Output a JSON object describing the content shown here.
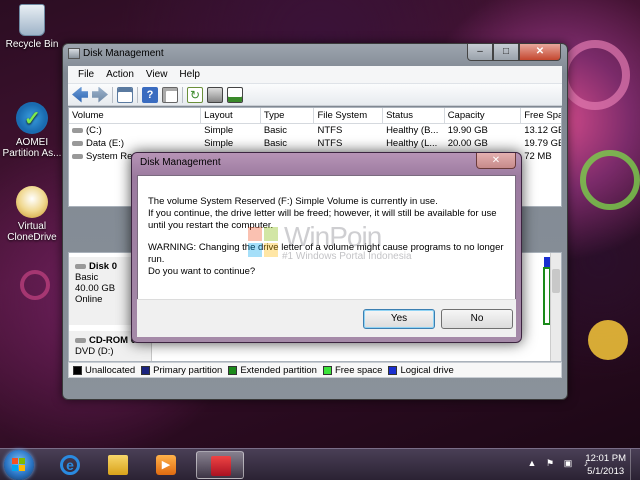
{
  "desktop": {
    "icons": [
      {
        "label": "Recycle Bin"
      },
      {
        "label": "AOMEI Partition As..."
      },
      {
        "label": "Virtual CloneDrive"
      }
    ]
  },
  "window": {
    "title": "Disk Management",
    "controls": {
      "minimize": "–",
      "maximize": "□",
      "close": "✕"
    },
    "menu": [
      "File",
      "Action",
      "View",
      "Help"
    ],
    "table": {
      "columns": [
        "Volume",
        "Layout",
        "Type",
        "File System",
        "Status",
        "Capacity",
        "Free Spa..."
      ],
      "rows": [
        {
          "volume": "(C:)",
          "layout": "Simple",
          "type": "Basic",
          "fs": "NTFS",
          "status": "Healthy (B...",
          "capacity": "19.90 GB",
          "free": "13.12 GB"
        },
        {
          "volume": "Data (E:)",
          "layout": "Simple",
          "type": "Basic",
          "fs": "NTFS",
          "status": "Healthy (L...",
          "capacity": "20.00 GB",
          "free": "19.79 GB"
        },
        {
          "volume": "System Res",
          "layout": "",
          "type": "",
          "fs": "",
          "status": "",
          "capacity": "",
          "free": "72 MB"
        }
      ]
    },
    "disks": {
      "disk0": {
        "name": "Disk 0",
        "type": "Basic",
        "size": "40.00 GB",
        "status": "Online"
      },
      "cdrom": {
        "name": "CD-ROM 0",
        "label": "DVD (D:)"
      }
    },
    "legend": [
      {
        "label": "Unallocated",
        "color": "#000000"
      },
      {
        "label": "Primary partition",
        "color": "#1a237e"
      },
      {
        "label": "Extended partition",
        "color": "#1b8a1b"
      },
      {
        "label": "Free space",
        "color": "#3be33b"
      },
      {
        "label": "Logical drive",
        "color": "#1a2fd0"
      }
    ]
  },
  "dialog": {
    "title": "Disk Management",
    "close": "✕",
    "message1": "The volume System Reserved (F:) Simple Volume is currently in use.",
    "message2": " If you continue, the drive letter will be freed; however, it will still be available for use until you restart the computer.",
    "warning": "WARNING: Changing the drive letter of a volume might cause programs to no longer run.",
    "question": "Do you want to continue?",
    "yes_label": "Yes",
    "no_label": "No"
  },
  "watermark": {
    "name": "WinPoin",
    "subtitle": "#1 Windows Portal Indonesia"
  },
  "taskbar": {
    "time": "12:01 PM",
    "date": "5/1/2013",
    "apps": [
      "internet-explorer",
      "windows-explorer",
      "media-player",
      "disk-management"
    ]
  }
}
